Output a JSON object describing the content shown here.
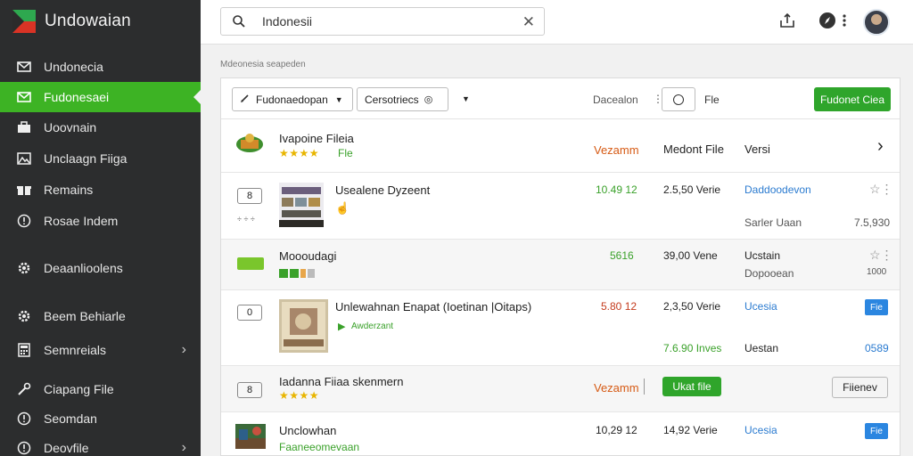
{
  "app": {
    "title": "Undowaian"
  },
  "sidebar": {
    "items": [
      {
        "label": "Undonecia",
        "icon": "mail-icon"
      },
      {
        "label": "Fudonesaei",
        "icon": "mail-icon"
      },
      {
        "label": "Uoovnain",
        "icon": "briefcase-icon"
      },
      {
        "label": "Unclaagn Fiiga",
        "icon": "image-icon"
      },
      {
        "label": "Remains",
        "icon": "gift-icon"
      },
      {
        "label": "Rosae Indem",
        "icon": "info-icon"
      },
      {
        "label": "Deaanlioolens",
        "icon": "gear-icon"
      },
      {
        "label": "Beem Behiarle",
        "icon": "gear-icon"
      },
      {
        "label": "Semnreials",
        "icon": "calculator-icon"
      },
      {
        "label": "Ciapang File",
        "icon": "wrench-icon"
      },
      {
        "label": "Seomdan",
        "icon": "info-icon"
      },
      {
        "label": "Deovfile",
        "icon": "info-icon"
      }
    ]
  },
  "search": {
    "value": "Indonesii"
  },
  "section_label": "Mdeonesia seapeden",
  "toolbar": {
    "dropdown1": "Fudonaedopan",
    "dropdown2": "Cersotriecs",
    "label": "Dacealon",
    "file": "Fle",
    "button": "Fudonet Ciea"
  },
  "rows": [
    {
      "title": "Ivapoine Fileia",
      "subtitle": "Fle",
      "col1": "Vezamm",
      "col2": "Medont File",
      "col3": "Versi"
    },
    {
      "num": "8",
      "title": "Usealene Dyzeent",
      "small": "÷ ÷ ÷",
      "col1": "10.49 12",
      "col2": "2.5,50 Verie",
      "col3": "Daddoodevon",
      "col3b": "Sarler Uaan",
      "col4": "7.5,930"
    },
    {
      "title": "Moooudagi",
      "col1": "5616",
      "col2": "39,00 Vene",
      "col3": "Ucstain",
      "col3b": "Dopooean",
      "col4": "1000"
    },
    {
      "num": "0",
      "title": "Unlewahnan Enapat (Ioetinan |Oitaps)",
      "subtitle": "Awderzant",
      "col1": "5.80 12",
      "col2": "2,3,50 Verie",
      "col2b": "7.6.90 Inves",
      "col3": "Ucesia",
      "col3b": "Uestan",
      "tag": "Fie",
      "col4": "0589"
    },
    {
      "num": "8",
      "title": "Iadanna Fiiaa skenmern",
      "col1": "Vezamm",
      "button": "Ukat file",
      "button2": "Fiienev"
    },
    {
      "title": "Unclowhan",
      "subtitle": "Faaneeomevaan",
      "col1": "10,29 12",
      "col2": "14,92 Verie",
      "col3": "Ucesia",
      "tag": "Fie"
    }
  ]
}
